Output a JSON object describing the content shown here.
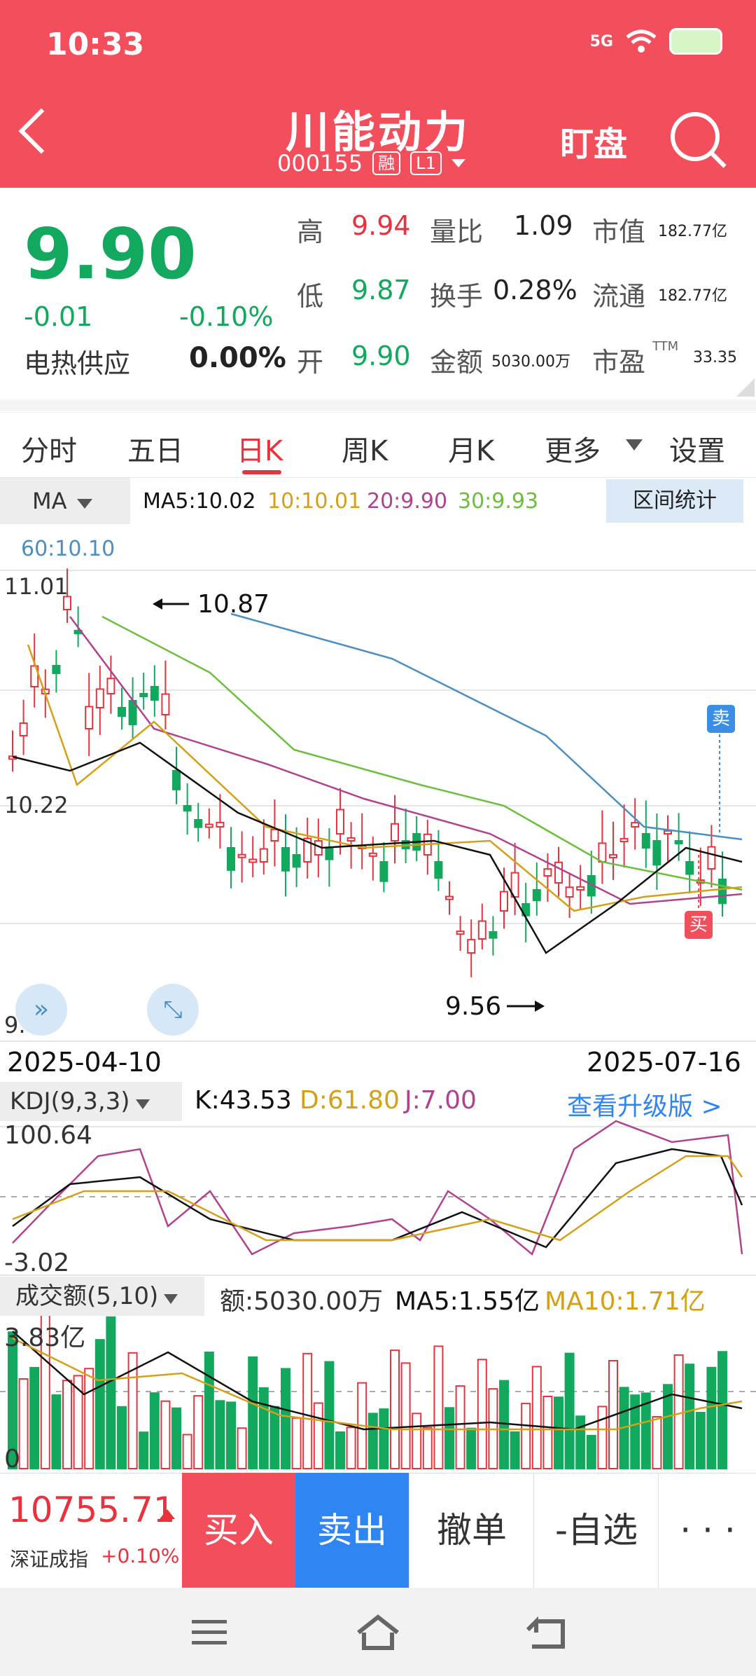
{
  "status": {
    "time": "10:33",
    "network": "5G"
  },
  "header": {
    "title": "川能动力",
    "code": "000155",
    "tag1": "融",
    "tag2": "L1",
    "watch": "盯盘"
  },
  "quote": {
    "price": "9.90",
    "change": "-0.01",
    "change_pct": "-0.10%",
    "sector": "电热供应",
    "sector_change": "0.00%",
    "high_label": "高",
    "high": "9.94",
    "low_label": "低",
    "low": "9.87",
    "open_label": "开",
    "open": "9.90",
    "vr_label": "量比",
    "vr": "1.09",
    "turnover_label": "换手",
    "turnover": "0.28%",
    "amount_label": "金额",
    "amount": "5030.00万",
    "mcap_label": "市值",
    "mcap": "182.77亿",
    "float_label": "流通",
    "float": "182.77亿",
    "pe_label": "市盈",
    "pe_sup": "TTM",
    "pe": "33.35"
  },
  "tabs": [
    "分时",
    "五日",
    "日K",
    "周K",
    "月K",
    "更多",
    "设置"
  ],
  "ma": {
    "selector": "MA",
    "ma5": "MA5:10.02",
    "ma10": "10:10.01",
    "ma20": "20:9.90",
    "ma30": "30:9.93",
    "ma60": "60:10.10",
    "range_button": "区间统计"
  },
  "colors": {
    "up": "#e8333e",
    "down": "#12a85d",
    "ma5": "#111111",
    "ma10": "#d4a017",
    "ma20": "#b0428f",
    "ma30": "#6cbf3d",
    "ma60": "#4a8ec2",
    "header": "#f24e5c"
  },
  "kline": {
    "y_max": "11.01",
    "y_mid": "10.22",
    "y_min": "9.42",
    "high_mark": "10.87",
    "low_mark": "9.56",
    "sell_tag": "卖",
    "buy_tag": "买",
    "date_start": "2025-04-10",
    "date_end": "2025-07-16"
  },
  "kdj": {
    "selector": "KDJ(9,3,3)",
    "k": "K:43.53",
    "d": "D:61.80",
    "j": "J:7.00",
    "upgrade": "查看升级版 >",
    "y_max": "100.64",
    "y_min": "-3.02"
  },
  "volume": {
    "selector": "成交额(5,10)",
    "amount": "额:5030.00万",
    "ma5": "MA5:1.55亿",
    "ma10": "MA10:1.71亿",
    "y_max": "3.83亿",
    "y_min": "0"
  },
  "bottom": {
    "index_value": "10755.71",
    "index_name": "深证成指",
    "index_change": "+0.10%",
    "buy": "买入",
    "sell": "卖出",
    "cancel": "撤单",
    "watchlist": "-自选",
    "more": "· · ·"
  }
}
